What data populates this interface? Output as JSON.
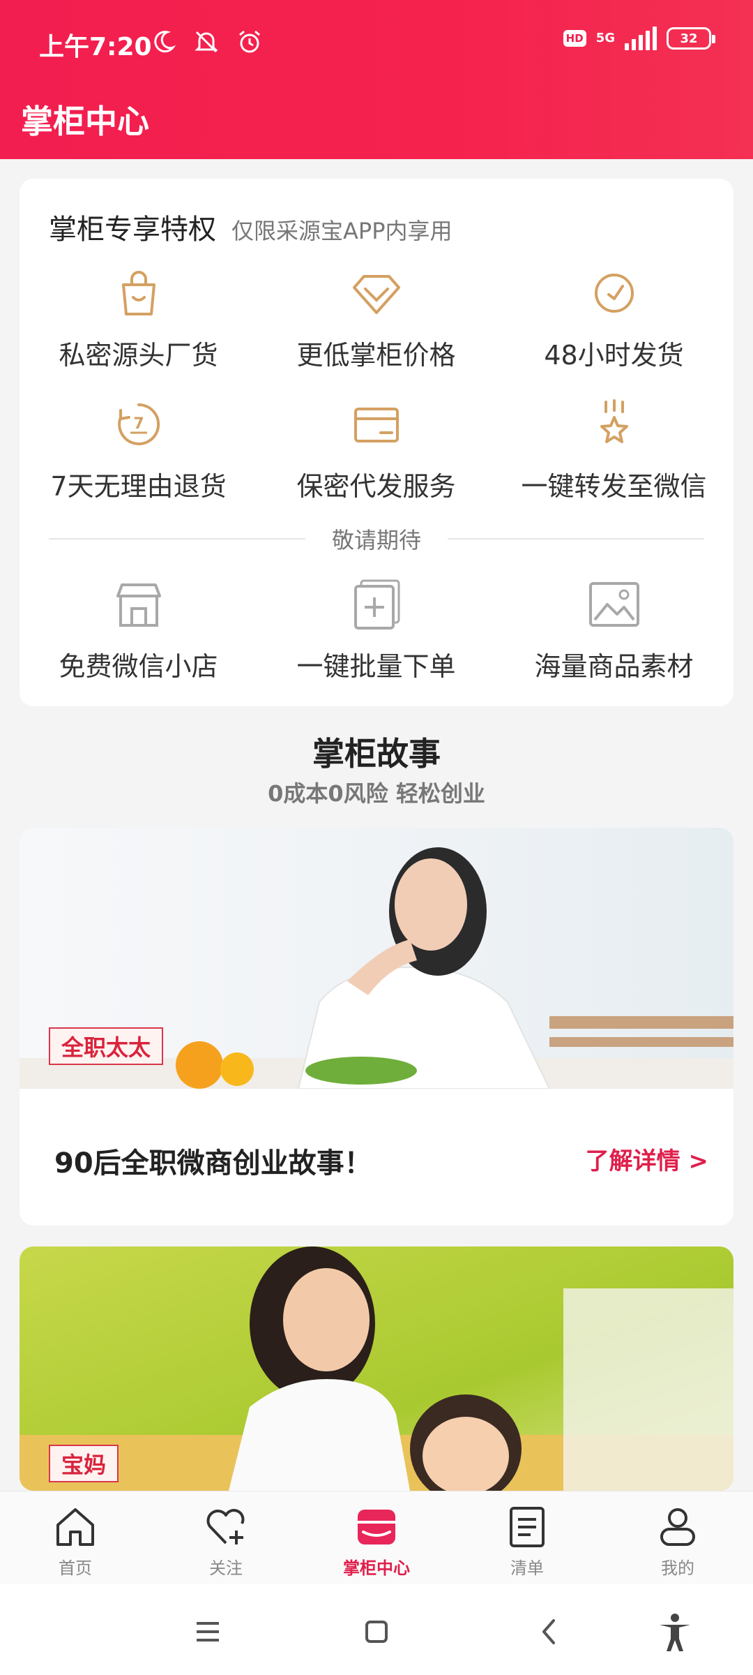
{
  "status_bar": {
    "time": "上午7:20",
    "hd": "HD",
    "network": "5G",
    "battery": "32"
  },
  "header": {
    "title": "掌柜中心"
  },
  "perks": {
    "title": "掌柜专享特权",
    "subtitle": "仅限采源宝APP内享用",
    "items": [
      {
        "label": "私密源头厂货",
        "icon": "shopping-bag-icon"
      },
      {
        "label": "更低掌柜价格",
        "icon": "diamond-icon"
      },
      {
        "label": "48小时发货",
        "icon": "clock-icon"
      },
      {
        "label": "7天无理由退货",
        "icon": "seven-day-return-icon"
      },
      {
        "label": "保密代发服务",
        "icon": "package-icon"
      },
      {
        "label": "一键转发至微信",
        "icon": "star-share-icon"
      }
    ],
    "coming_soon_label": "敬请期待",
    "coming_soon": [
      {
        "label": "免费微信小店",
        "icon": "shop-icon"
      },
      {
        "label": "一键批量下单",
        "icon": "batch-add-icon"
      },
      {
        "label": "海量商品素材",
        "icon": "image-icon"
      }
    ]
  },
  "stories": {
    "title": "掌柜故事",
    "subtitle": "0成本0风险 轻松创业",
    "cards": [
      {
        "tag": "全职太太",
        "text": "90后全职微商创业故事！",
        "link": "了解详情 >"
      },
      {
        "tag": "宝妈"
      }
    ]
  },
  "tabbar": [
    {
      "label": "首页",
      "icon": "home-icon"
    },
    {
      "label": "关注",
      "icon": "heart-plus-icon"
    },
    {
      "label": "掌柜中心",
      "icon": "store-icon",
      "active": true
    },
    {
      "label": "清单",
      "icon": "list-icon"
    },
    {
      "label": "我的",
      "icon": "profile-icon"
    }
  ],
  "colors": {
    "accent": "#f21e4f",
    "gold_icon": "#d4a061",
    "gray_icon": "#a8a8a8",
    "tag_red": "#d9243c"
  }
}
